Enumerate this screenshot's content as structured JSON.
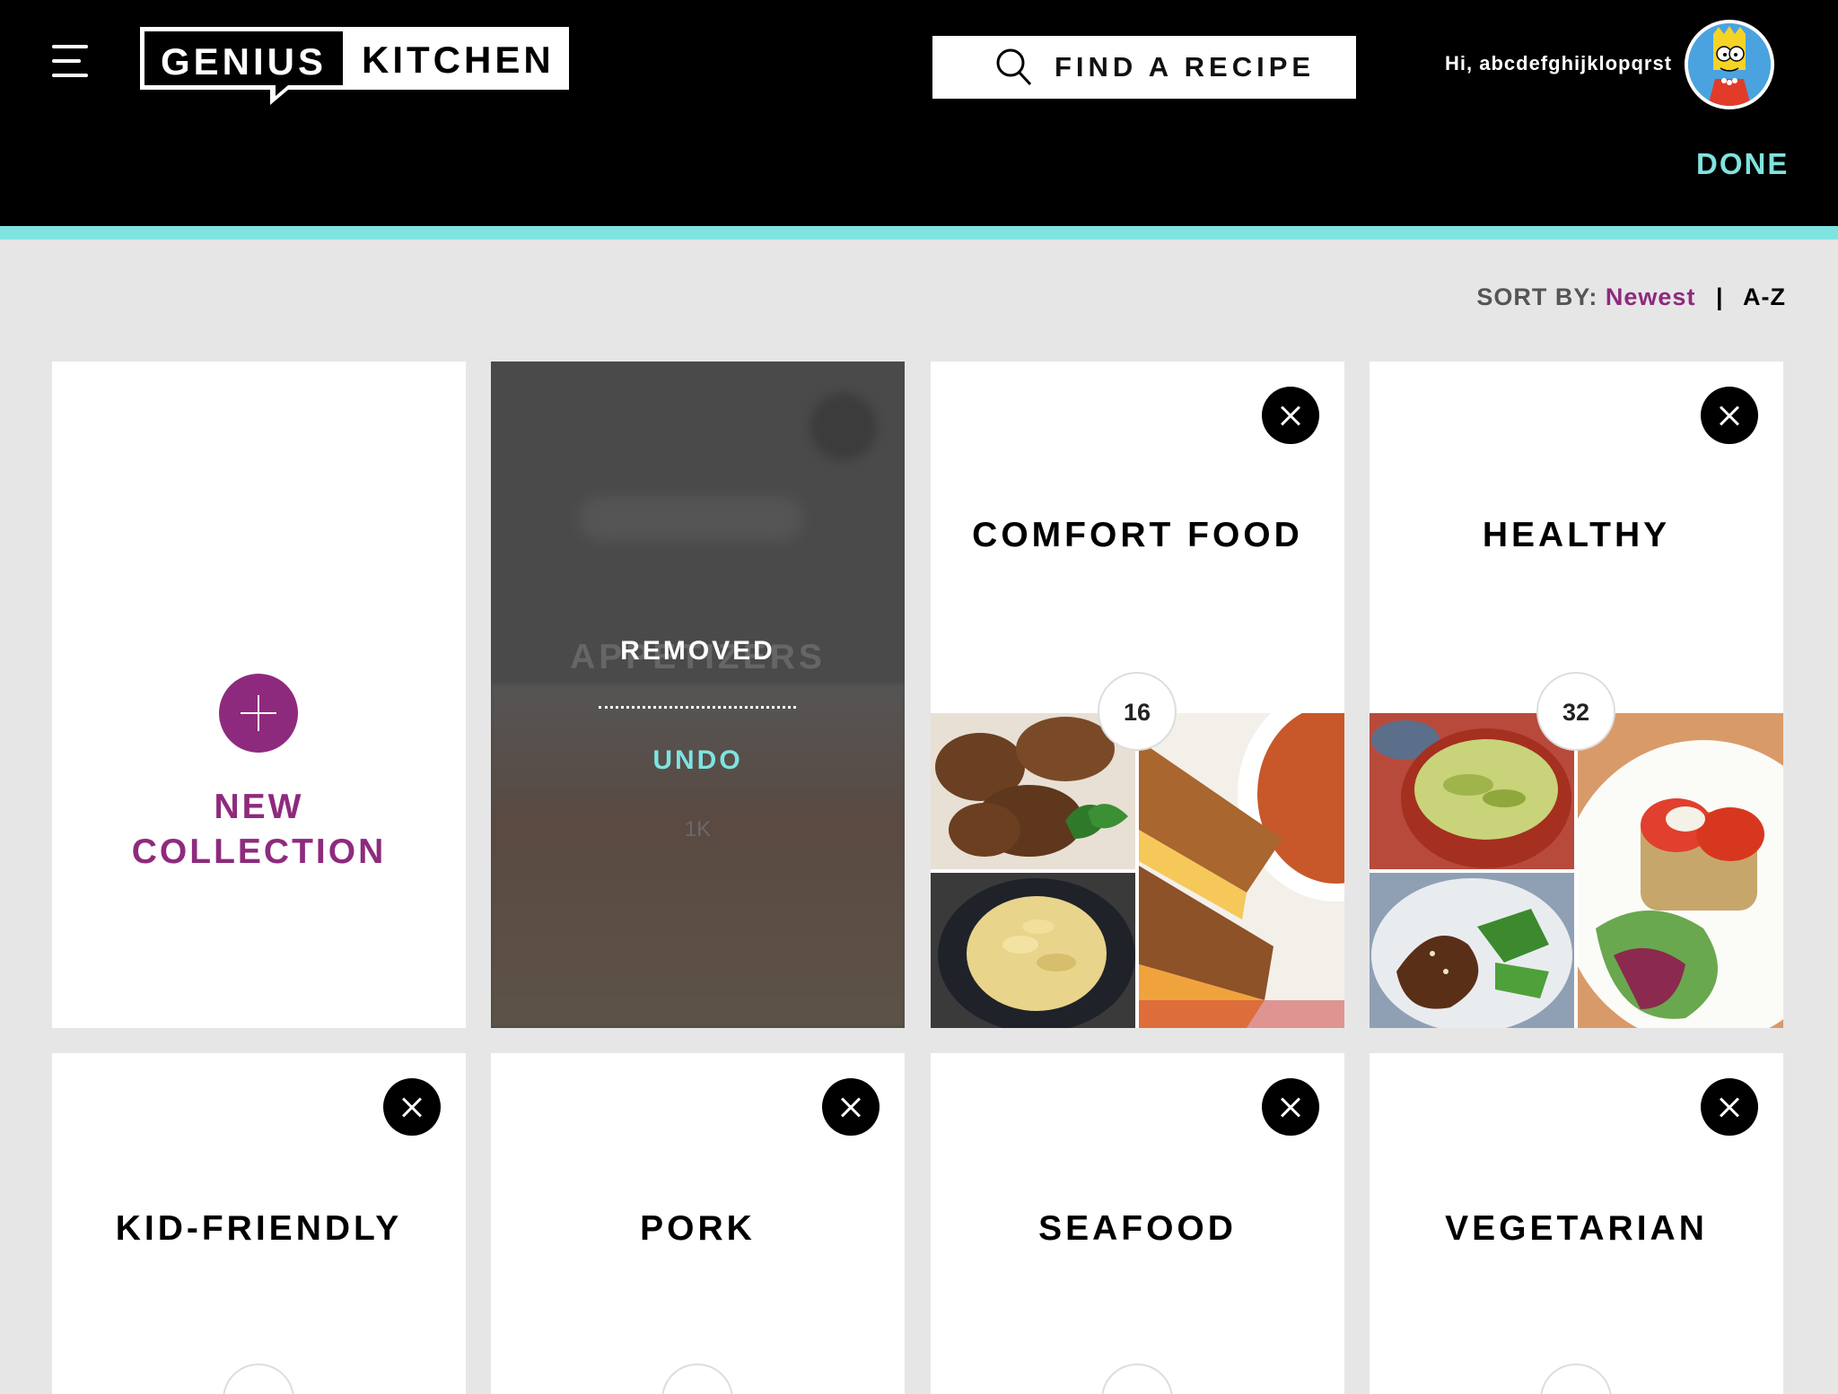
{
  "header": {
    "logo_left": "GENIUS",
    "logo_right": "KITCHEN",
    "search_placeholder": "FIND A RECIPE",
    "greeting": "Hi, abcdefghijklopqrst",
    "done_label": "DONE"
  },
  "sort": {
    "label": "SORT BY:",
    "options": [
      "Newest",
      "A-Z"
    ],
    "active": "Newest",
    "separator": "|"
  },
  "new_collection": {
    "line1": "NEW",
    "line2": "COLLECTION"
  },
  "removed_card": {
    "ghost_title": "APPETIZERS",
    "ghost_count": "1K",
    "removed_label": "REMOVED",
    "undo_label": "UNDO"
  },
  "collections": [
    {
      "title": "COMFORT FOOD",
      "count": "16"
    },
    {
      "title": "HEALTHY",
      "count": "32"
    },
    {
      "title": "KID-FRIENDLY",
      "count": ""
    },
    {
      "title": "PORK",
      "count": ""
    },
    {
      "title": "SEAFOOD",
      "count": ""
    },
    {
      "title": "VEGETARIAN",
      "count": ""
    }
  ],
  "colors": {
    "accent": "#7fe3df",
    "brand_purple": "#8e2a7d",
    "header_bg": "#000000",
    "page_bg": "#e6e6e6"
  },
  "icons": [
    "menu-icon",
    "search-icon",
    "close-icon",
    "plus-icon"
  ]
}
